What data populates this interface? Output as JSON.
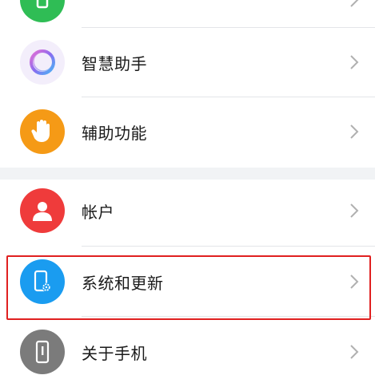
{
  "settings": {
    "items": [
      {
        "key": "partial-top",
        "label": "",
        "icon": "battery-icon",
        "color": "#2fbd55"
      },
      {
        "key": "assistant",
        "label": "智慧助手",
        "icon": "assistant-ring-icon",
        "color": "#b56ee8"
      },
      {
        "key": "accessibility",
        "label": "辅助功能",
        "icon": "hand-icon",
        "color": "#f59a16"
      },
      {
        "key": "account",
        "label": "帐户",
        "icon": "person-icon",
        "color": "#ef3b3b"
      },
      {
        "key": "system",
        "label": "系统和更新",
        "icon": "phone-gear-icon",
        "color": "#1a9cf0"
      },
      {
        "key": "about",
        "label": "关于手机",
        "icon": "phone-info-icon",
        "color": "#7b7b7b"
      }
    ]
  },
  "highlight": {
    "target": "system",
    "color": "#e02020"
  }
}
